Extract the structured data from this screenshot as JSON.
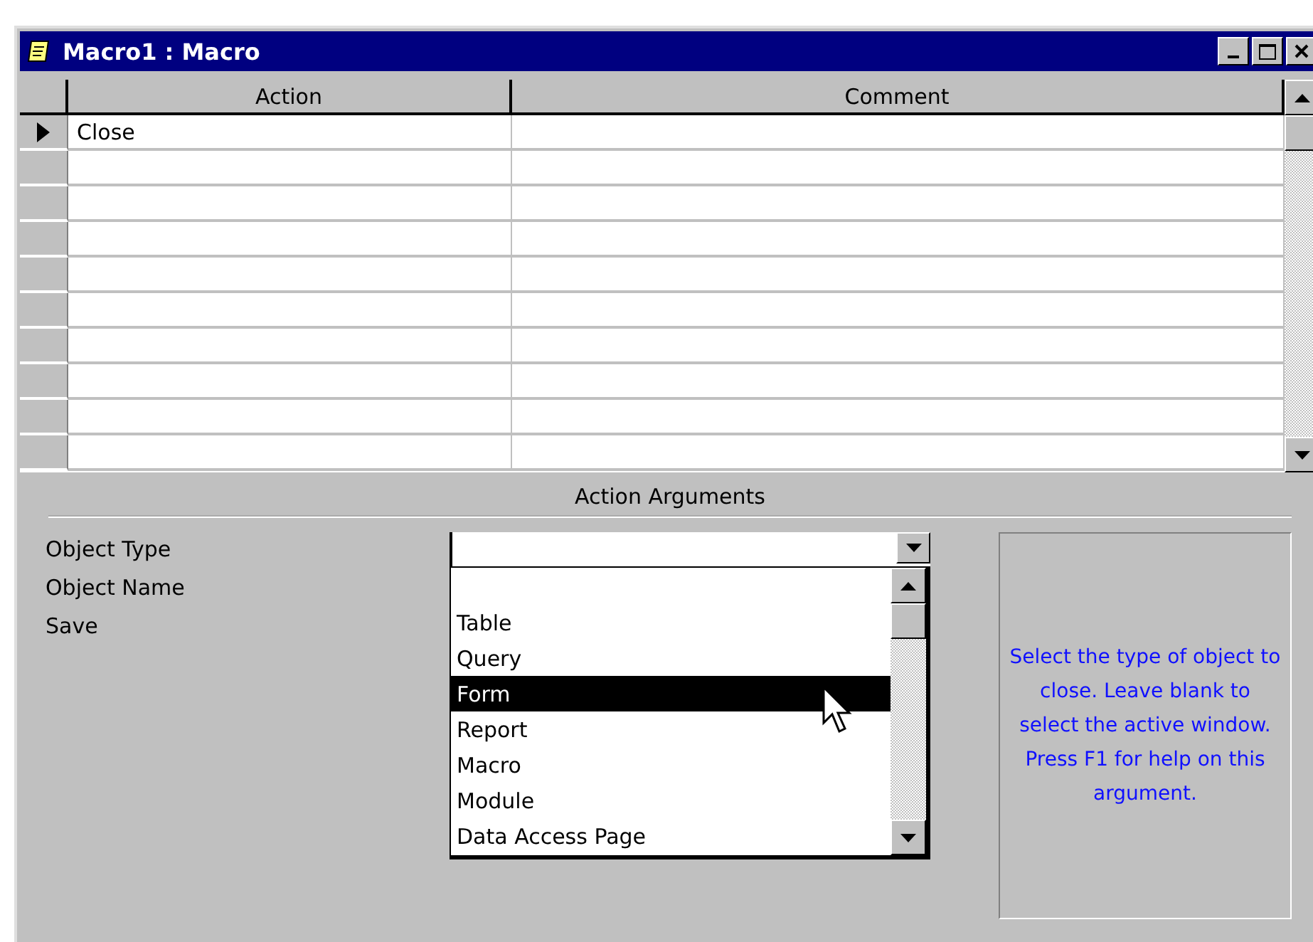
{
  "window": {
    "title": "Macro1 : Macro"
  },
  "grid": {
    "columns": [
      "Action",
      "Comment"
    ],
    "rows": [
      {
        "action": "Close",
        "selected": true
      }
    ]
  },
  "arguments": {
    "title": "Action Arguments",
    "fields": [
      {
        "label": "Object Type"
      },
      {
        "label": "Object Name"
      },
      {
        "label": "Save"
      }
    ],
    "dropdown": {
      "options": [
        {
          "label": "Table",
          "selected": false
        },
        {
          "label": "Query",
          "selected": false
        },
        {
          "label": "Form",
          "selected": true
        },
        {
          "label": "Report",
          "selected": false
        },
        {
          "label": "Macro",
          "selected": false
        },
        {
          "label": "Module",
          "selected": false
        },
        {
          "label": "Data Access Page",
          "selected": false
        }
      ]
    },
    "help": "Select the type of object to close. Leave blank to select the active window. Press F1 for help on this argument."
  }
}
